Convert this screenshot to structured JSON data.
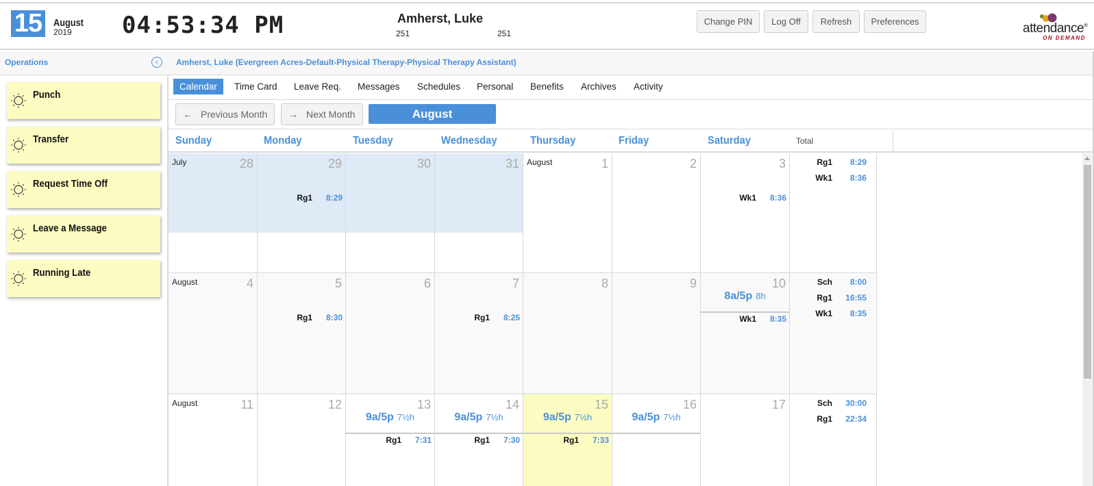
{
  "header": {
    "day": "15",
    "month": "August",
    "year": "2019",
    "clock": "04:53:34 PM",
    "user_name": "Amherst, Luke",
    "user_id_1": "251",
    "user_id_2": "251",
    "buttons": [
      "Change PIN",
      "Log Off",
      "Refresh",
      "Preferences"
    ],
    "logo_text": "attendance",
    "logo_reg": "®",
    "logo_sub": "ON DEMAND"
  },
  "subbar": {
    "operations_label": "Operations",
    "collapse_icon": "‹",
    "employee_title": "Amherst, Luke (Evergreen Acres-Default-Physical Therapy-Physical Therapy Assistant)"
  },
  "operations": [
    {
      "label": "Punch",
      "icon": "sun-icon"
    },
    {
      "label": "Transfer",
      "icon": "sun-icon"
    },
    {
      "label": "Request Time Off",
      "icon": "sun-icon"
    },
    {
      "label": "Leave a Message",
      "icon": "sun-icon"
    },
    {
      "label": "Running Late",
      "icon": "sun-icon"
    }
  ],
  "tabs": [
    {
      "label": "Calendar",
      "active": true
    },
    {
      "label": "Time Card"
    },
    {
      "label": "Leave Req."
    },
    {
      "label": "Messages"
    },
    {
      "label": "Schedules"
    },
    {
      "label": "Personal"
    },
    {
      "label": "Benefits"
    },
    {
      "label": "Archives"
    },
    {
      "label": "Activity"
    }
  ],
  "nav": {
    "prev_arrow": "←",
    "prev_label": "Previous Month",
    "next_arrow": "→",
    "next_label": "Next Month",
    "current_month": "August"
  },
  "calendar": {
    "days": [
      "Sunday",
      "Monday",
      "Tuesday",
      "Wednesday",
      "Thursday",
      "Friday",
      "Saturday"
    ],
    "total_label": "Total",
    "weeks": [
      {
        "cells": [
          {
            "month_label": "July",
            "day": "28",
            "other_month": true
          },
          {
            "day": "29",
            "other_month": true,
            "entries": [
              {
                "code": "Rg1",
                "hours": "8:29"
              }
            ]
          },
          {
            "day": "30",
            "other_month": true
          },
          {
            "day": "31",
            "other_month": true
          },
          {
            "month_label": "August",
            "day": "1"
          },
          {
            "day": "2"
          },
          {
            "day": "3",
            "entries": [
              {
                "code": "Wk1",
                "hours": "8:36"
              }
            ]
          }
        ],
        "totals": [
          {
            "code": "Rg1",
            "hours": "8:29"
          },
          {
            "code": "Wk1",
            "hours": "8:36"
          }
        ]
      },
      {
        "cells": [
          {
            "month_label": "August",
            "day": "4"
          },
          {
            "day": "5",
            "entries": [
              {
                "code": "Rg1",
                "hours": "8:30"
              }
            ]
          },
          {
            "day": "6"
          },
          {
            "day": "7",
            "entries": [
              {
                "code": "Rg1",
                "hours": "8:25"
              }
            ]
          },
          {
            "day": "8"
          },
          {
            "day": "9"
          },
          {
            "day": "10",
            "schedule": {
              "time": "8a/5p",
              "hours": "8h"
            },
            "entries": [
              {
                "code": "Wk1",
                "hours": "8:35"
              }
            ]
          }
        ],
        "totals": [
          {
            "code": "Sch",
            "hours": "8:00"
          },
          {
            "code": "Rg1",
            "hours": "16:55"
          },
          {
            "code": "Wk1",
            "hours": "8:35"
          }
        ]
      },
      {
        "cells": [
          {
            "month_label": "August",
            "day": "11"
          },
          {
            "day": "12"
          },
          {
            "day": "13",
            "schedule": {
              "time": "9a/5p",
              "hours": "7½h"
            },
            "entries": [
              {
                "code": "Rg1",
                "hours": "7:31"
              }
            ]
          },
          {
            "day": "14",
            "schedule": {
              "time": "9a/5p",
              "hours": "7½h"
            },
            "entries": [
              {
                "code": "Rg1",
                "hours": "7:30"
              }
            ]
          },
          {
            "day": "15",
            "today": true,
            "schedule": {
              "time": "9a/5p",
              "hours": "7½h"
            },
            "entries": [
              {
                "code": "Rg1",
                "hours": "7:33"
              }
            ]
          },
          {
            "day": "16",
            "schedule": {
              "time": "9a/5p",
              "hours": "7½h"
            }
          },
          {
            "day": "17"
          }
        ],
        "totals": [
          {
            "code": "Sch",
            "hours": "30:00"
          },
          {
            "code": "Rg1",
            "hours": "22:34"
          }
        ]
      }
    ]
  },
  "colors": {
    "accent": "#4a90d9",
    "other_month_bg": "#deeaf6",
    "week2_bg": "#f9f9f9",
    "today_bg": "#fcfcc2",
    "op_card_bg": "#fcfcc2"
  }
}
